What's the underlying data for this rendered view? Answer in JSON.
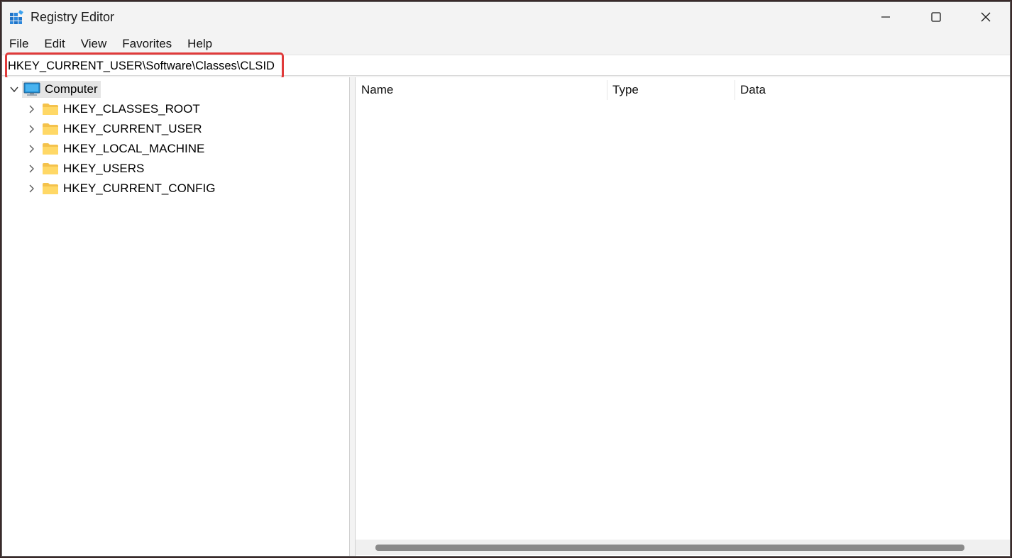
{
  "window": {
    "title": "Registry Editor",
    "accent_highlight_color": "#e03a3a"
  },
  "menu": [
    "File",
    "Edit",
    "View",
    "Favorites",
    "Help"
  ],
  "address": {
    "path": "HKEY_CURRENT_USER\\Software\\Classes\\CLSID"
  },
  "tree": {
    "root": {
      "label": "Computer",
      "icon": "computer-icon",
      "expanded": true
    },
    "children": [
      {
        "label": "HKEY_CLASSES_ROOT",
        "icon": "folder-icon"
      },
      {
        "label": "HKEY_CURRENT_USER",
        "icon": "folder-icon"
      },
      {
        "label": "HKEY_LOCAL_MACHINE",
        "icon": "folder-icon"
      },
      {
        "label": "HKEY_USERS",
        "icon": "folder-icon"
      },
      {
        "label": "HKEY_CURRENT_CONFIG",
        "icon": "folder-icon"
      }
    ]
  },
  "list": {
    "columns": [
      "Name",
      "Type",
      "Data"
    ]
  }
}
